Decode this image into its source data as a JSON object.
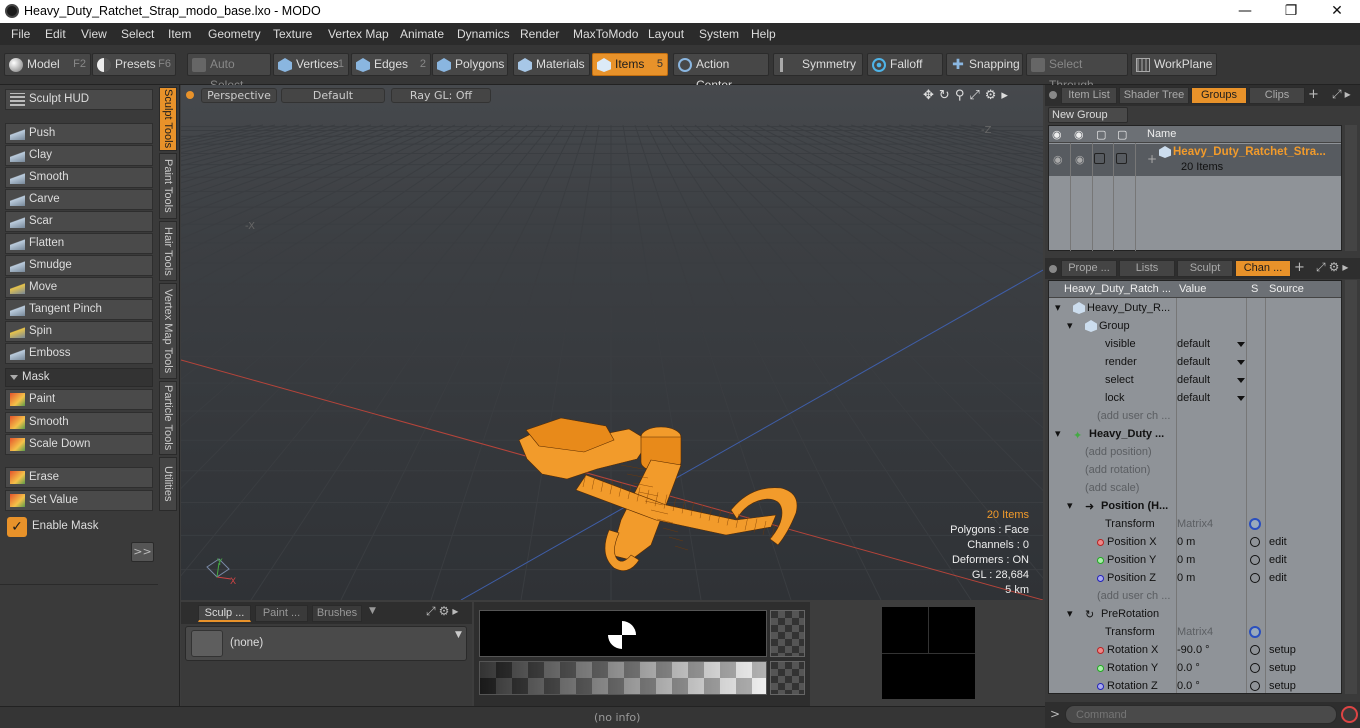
{
  "window": {
    "title": "Heavy_Duty_Ratchet_Strap_modo_base.lxo - MODO"
  },
  "menu": [
    "File",
    "Edit",
    "View",
    "Select",
    "Item",
    "Geometry",
    "Texture",
    "Vertex Map",
    "Animate",
    "Dynamics",
    "Render",
    "MaxToModo",
    "Layout",
    "System",
    "Help"
  ],
  "toolbar": {
    "model": "Model",
    "model_key": "F2",
    "presets": "Presets",
    "presets_key": "F6",
    "auto_select": "Auto Select",
    "vertices": "Vertices",
    "vertices_key": "1",
    "edges": "Edges",
    "edges_key": "2",
    "polygons": "Polygons",
    "materials": "Materials",
    "items": "Items",
    "items_key": "5",
    "action_center": "Action Center",
    "symmetry": "Symmetry",
    "falloff": "Falloff",
    "snapping": "Snapping",
    "select_through": "Select Through",
    "workplane": "WorkPlane"
  },
  "left": {
    "sculpt_hud": "Sculpt HUD",
    "tools": [
      "Push",
      "Clay",
      "Smooth",
      "Carve",
      "Scar",
      "Flatten",
      "Smudge",
      "Move",
      "Tangent Pinch",
      "Spin",
      "Emboss"
    ],
    "mask_header": "Mask",
    "mask_tools": [
      "Paint",
      "Smooth",
      "Scale Down"
    ],
    "erase": "Erase",
    "set_value": "Set Value",
    "enable_mask": "Enable Mask",
    "more": ">>",
    "vtabs": [
      "Sculpt Tools",
      "Paint Tools",
      "Hair Tools",
      "Vertex Map Tools",
      "Particle Tools",
      "Utilities"
    ]
  },
  "viewport": {
    "perspective": "Perspective",
    "shading": "Default",
    "raygl": "Ray GL: Off",
    "axis_minus_x": "-X",
    "axis_minus_z": "-Z",
    "info": {
      "items": "20 Items",
      "polygons": "Polygons : Face",
      "channels": "Channels : 0",
      "deformers": "Deformers : ON",
      "gl": "GL : 28,684",
      "scale": "5 km"
    }
  },
  "bottom": {
    "tabs": [
      "Sculp ...",
      "Paint ...",
      "Brushes"
    ],
    "brush_none": "(none)",
    "status": "(no info)"
  },
  "right_top": {
    "tabs": [
      "Item List",
      "Shader Tree",
      "Groups",
      "Clips"
    ],
    "new_group": "New Group",
    "col_name": "Name",
    "group_name": "Heavy_Duty_Ratchet_Stra...",
    "group_count": "20 Items"
  },
  "right_bottom": {
    "tabs": [
      "Prope ...",
      "Lists",
      "Sculpt",
      "Chan ..."
    ],
    "col_name": "Heavy_Duty_Ratch ...",
    "col_value": "Value",
    "col_s": "S",
    "col_source": "Source",
    "rows": [
      {
        "label": "Heavy_Duty_R...",
        "value": "",
        "source": ""
      },
      {
        "label": "Group",
        "value": "",
        "source": ""
      },
      {
        "label": "visible",
        "value": "default",
        "source": ""
      },
      {
        "label": "render",
        "value": "default",
        "source": ""
      },
      {
        "label": "select",
        "value": "default",
        "source": ""
      },
      {
        "label": "lock",
        "value": "default",
        "source": ""
      },
      {
        "label": "(add user ch ...",
        "value": "",
        "source": ""
      },
      {
        "label": "Heavy_Duty ...",
        "value": "",
        "source": ""
      },
      {
        "label": "(add position)",
        "value": "",
        "source": ""
      },
      {
        "label": "(add rotation)",
        "value": "",
        "source": ""
      },
      {
        "label": "(add scale)",
        "value": "",
        "source": ""
      },
      {
        "label": "Position (H...",
        "value": "",
        "source": ""
      },
      {
        "label": "Transform",
        "value": "Matrix4",
        "source": ""
      },
      {
        "label": "Position X",
        "value": "0 m",
        "source": "edit"
      },
      {
        "label": "Position Y",
        "value": "0 m",
        "source": "edit"
      },
      {
        "label": "Position Z",
        "value": "0 m",
        "source": "edit"
      },
      {
        "label": "(add user ch ...",
        "value": "",
        "source": ""
      },
      {
        "label": "PreRotation",
        "value": "",
        "source": ""
      },
      {
        "label": "Transform",
        "value": "Matrix4",
        "source": ""
      },
      {
        "label": "Rotation X",
        "value": "-90.0 °",
        "source": "setup"
      },
      {
        "label": "Rotation Y",
        "value": "0.0 °",
        "source": "setup"
      },
      {
        "label": "Rotation Z",
        "value": "0.0 °",
        "source": "setup"
      }
    ]
  },
  "command": {
    "placeholder": "Command",
    "prompt": ">"
  },
  "colors": {
    "accent": "#e8922a",
    "viewport_bg": "#3c3f43",
    "selection": "#ff8c00"
  }
}
